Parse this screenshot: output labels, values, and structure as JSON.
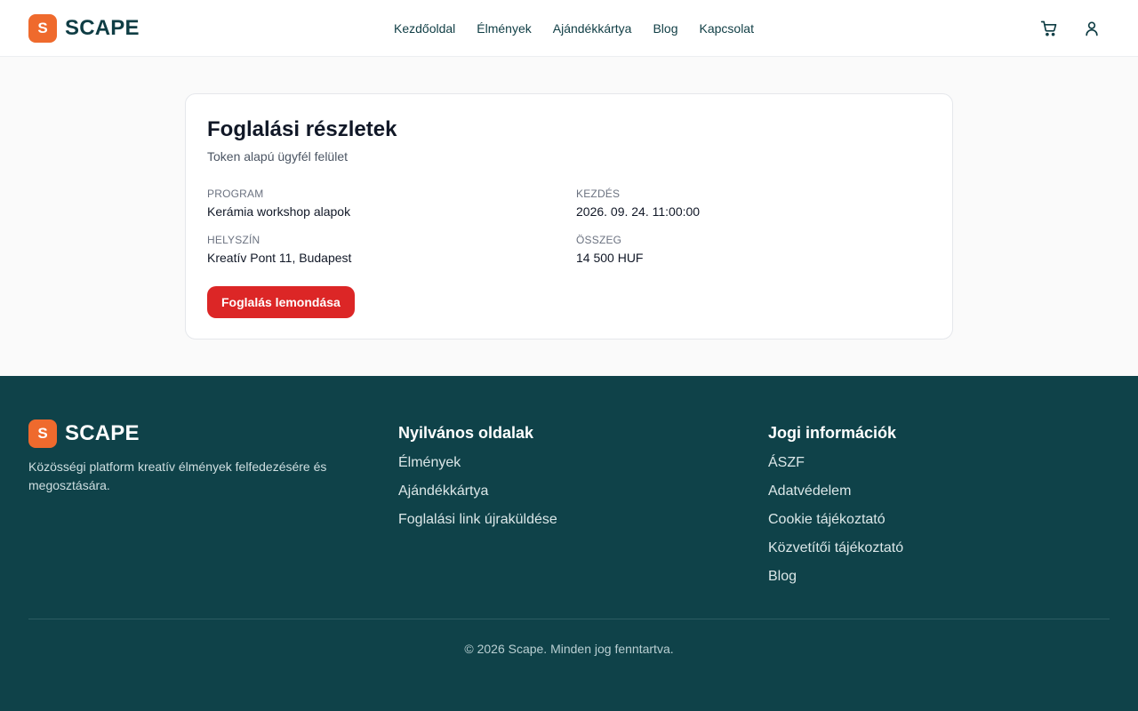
{
  "brand": {
    "initial": "S",
    "name": "SCAPE",
    "accent": "#ef6a2d",
    "dark": "#0f4249"
  },
  "nav": {
    "items": [
      "Kezdőoldal",
      "Élmények",
      "Ajándékkártya",
      "Blog",
      "Kapcsolat"
    ]
  },
  "header_icons": {
    "cart": "cart-icon",
    "user": "user-icon"
  },
  "booking": {
    "title": "Foglalási részletek",
    "subtitle": "Token alapú ügyfél felület",
    "program_label": "PROGRAM",
    "program_value": "Kerámia workshop alapok",
    "start_label": "KEZDÉS",
    "start_value": "2026. 09. 24. 11:00:00",
    "location_label": "HELYSZÍN",
    "location_value": "Kreatív Pont 11, Budapest",
    "amount_label": "ÖSSZEG",
    "amount_value": "14 500 HUF",
    "cancel_label": "Foglalás lemondása",
    "cancel_color": "#dc2626"
  },
  "footer": {
    "description": "Közösségi platform kreatív élmények felfedezésére és megosztására.",
    "public": {
      "title": "Nyilvános oldalak",
      "links": [
        "Élmények",
        "Ajándékkártya",
        "Foglalási link újraküldése"
      ]
    },
    "legal": {
      "title": "Jogi információk",
      "links": [
        "ÁSZF",
        "Adatvédelem",
        "Cookie tájékoztató",
        "Közvetítői tájékoztató",
        "Blog"
      ]
    },
    "copyright": "© 2026 Scape. Minden jog fenntartva."
  }
}
